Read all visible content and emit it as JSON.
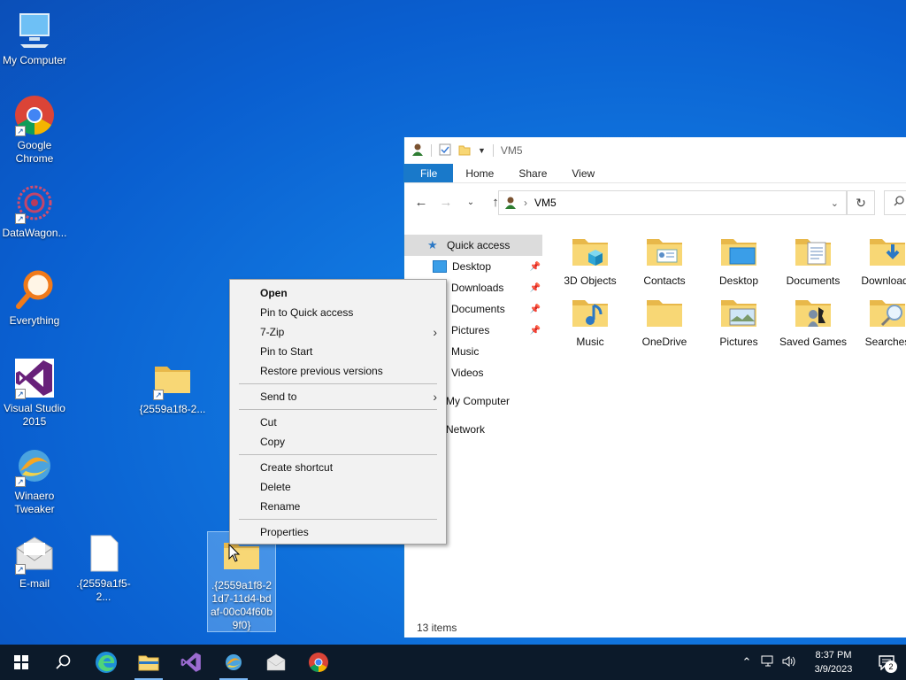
{
  "desktop": {
    "icons": [
      {
        "label": "My Computer"
      },
      {
        "label": "Google Chrome"
      },
      {
        "label": "DataWagon..."
      },
      {
        "label": "Everything"
      },
      {
        "label": "Visual Studio 2015"
      },
      {
        "label": "Winaero Tweaker"
      },
      {
        "label": "E-mail"
      },
      {
        "label": ".{2559a1f5-2..."
      },
      {
        "label": "{2559a1f8-2..."
      },
      {
        "label": ".{2559a1f8-21d7-11d4-bdaf-00c04f60b9f0}"
      }
    ]
  },
  "explorer": {
    "title": "VM5",
    "ribbon_tabs": [
      "File",
      "Home",
      "Share",
      "View"
    ],
    "address": "VM5",
    "nav": {
      "quick_access": "Quick access",
      "items": [
        "Desktop",
        "Downloads",
        "Documents",
        "Pictures",
        "Music",
        "Videos"
      ],
      "my_computer": "My Computer",
      "network": "Network"
    },
    "folders": [
      "3D Objects",
      "Contacts",
      "Desktop",
      "Documents",
      "Downloads",
      "Music",
      "OneDrive",
      "Pictures",
      "Saved Games",
      "Searches"
    ],
    "status": "13 items"
  },
  "context_menu": {
    "open": "Open",
    "pin_quick": "Pin to Quick access",
    "zip": "7-Zip",
    "pin_start": "Pin to Start",
    "restore": "Restore previous versions",
    "send_to": "Send to",
    "cut": "Cut",
    "copy": "Copy",
    "create_shortcut": "Create shortcut",
    "delete": "Delete",
    "rename": "Rename",
    "properties": "Properties"
  },
  "taskbar": {
    "time": "8:37 PM",
    "date": "3/9/2023",
    "notifications": "2"
  },
  "colors": {
    "accent": "#1979ca",
    "desktop": "#1178e0",
    "taskbar": "#0c1a2a"
  }
}
